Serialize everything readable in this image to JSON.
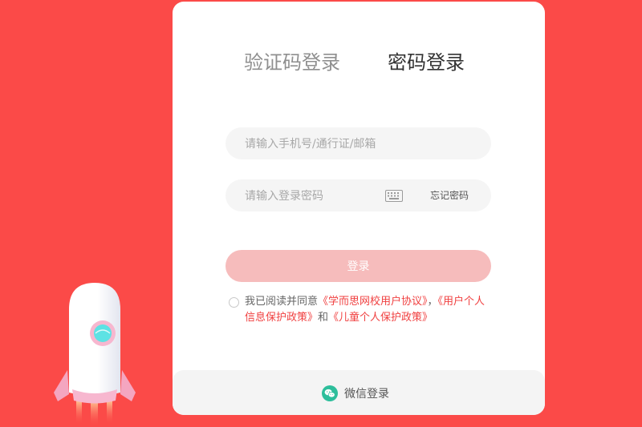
{
  "tabs": {
    "sms_label": "验证码登录",
    "password_label": "密码登录",
    "active": "password"
  },
  "account_input": {
    "placeholder": "请输入手机号/通行证/邮箱"
  },
  "password_input": {
    "placeholder": "请输入登录密码"
  },
  "forgot_label": "忘记密码",
  "login_button_label": "登录",
  "agreement": {
    "prefix": "我已阅读并同意",
    "user_agreement": "《学而思网校用户协议》",
    "separator": "，",
    "privacy_policy": "《用户个人信息保护政策》",
    "conjunction": "和",
    "child_policy": "《儿童个人保护政策》"
  },
  "wechat_login_label": "微信登录",
  "colors": {
    "background": "#fb4a48",
    "card": "#ffffff",
    "accent": "#f04040",
    "button_disabled": "#f6bcbc",
    "wechat": "#2dbe9b"
  },
  "icons": [
    "keyboard-icon",
    "radio-unchecked-icon",
    "wechat-icon",
    "rocket-illustration"
  ]
}
